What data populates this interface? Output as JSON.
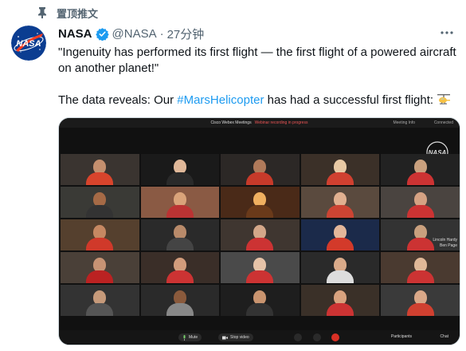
{
  "pinned": {
    "label": "置顶推文",
    "icon": "pin-icon"
  },
  "author": {
    "display_name": "NASA",
    "handle": "@NASA",
    "separator": "·",
    "time": "27分钟",
    "verified_icon": "verified-badge-icon",
    "avatar": "nasa-logo-avatar"
  },
  "tweet": {
    "quote": "\"Ingenuity has performed its first flight — the first flight of a powered aircraft on another planet!\"",
    "line2_prefix": "The data reveals: Our ",
    "hashtag": "#MarsHelicopter",
    "line2_suffix": " has had a successful first flight: ",
    "emoji": "helicopter-icon"
  },
  "media": {
    "meeting_title": "Cisco Webex Meetings",
    "meeting_status": "Webinar recording in progress",
    "meeting_info": "Meeting Info",
    "connected": "Connected",
    "tile_label_1": "Lincoln Hardy",
    "tile_label_2": "Ben Page",
    "controls": {
      "mute": "Mute",
      "video": "Stop video",
      "participants": "Participants",
      "chat": "Chat"
    }
  },
  "colors": {
    "accent": "#1d9bf0",
    "secondary_text": "#536471",
    "leave_red": "#d93025",
    "nasa_blue": "#0b3d91",
    "nasa_red": "#fc3d21"
  }
}
